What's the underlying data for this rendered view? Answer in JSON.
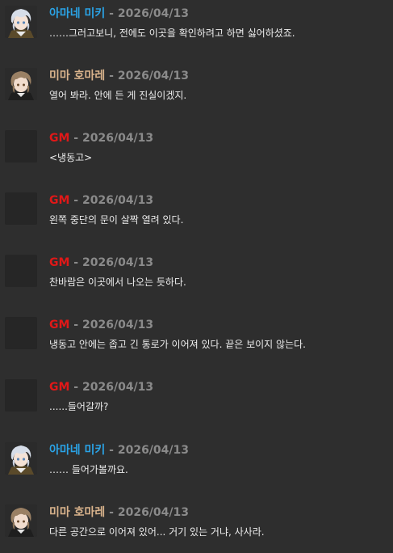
{
  "messages": [
    {
      "speaker": "아마네 미키",
      "avatar": "amane-avatar",
      "sep": " - ",
      "date": "2026/04/13",
      "text": "……그러고보니, 전에도 이곳을 확인하려고 하면 싫어하셨죠."
    },
    {
      "speaker": "미마 호마레",
      "avatar": "homare-avatar",
      "sep": " - ",
      "date": "2026/04/13",
      "text": "열어 봐라. 안에 든 게 진실이겠지."
    },
    {
      "speaker": "GM",
      "avatar": "blank",
      "sep": " - ",
      "date": "2026/04/13",
      "text": "<냉동고>"
    },
    {
      "speaker": "GM",
      "avatar": "blank",
      "sep": " - ",
      "date": "2026/04/13",
      "text": "왼쪽 중단의 문이 살짝 열려 있다."
    },
    {
      "speaker": "GM",
      "avatar": "blank",
      "sep": " - ",
      "date": "2026/04/13",
      "text": "찬바람은 이곳에서 나오는 듯하다."
    },
    {
      "speaker": "GM",
      "avatar": "blank",
      "sep": " - ",
      "date": "2026/04/13",
      "text": "냉동고 안에는 좁고 긴 통로가 이어져 있다. 끝은 보이지 않는다."
    },
    {
      "speaker": "GM",
      "avatar": "blank",
      "sep": " - ",
      "date": "2026/04/13",
      "text": "......들어갈까?"
    },
    {
      "speaker": "아마네 미키",
      "avatar": "amane-avatar",
      "sep": " - ",
      "date": "2026/04/13",
      "text": "…… 들어가볼까요."
    },
    {
      "speaker": "미마 호마레",
      "avatar": "homare-avatar",
      "sep": " - ",
      "date": "2026/04/13",
      "text": "다른 공간으로 이어져 있어... 거기 있는 거냐, 사사라."
    }
  ],
  "colors": {
    "background": "#2e2e2e",
    "amane_name": "#2aa3e6",
    "homare_name": "#d9b38c",
    "gm_name": "#e01818",
    "meta": "#8a8a8a",
    "text": "#ececec"
  }
}
